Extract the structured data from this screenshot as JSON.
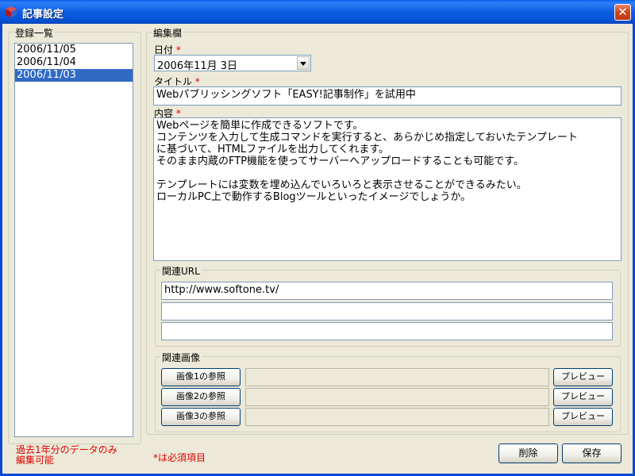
{
  "window": {
    "title": "記事設定",
    "close_label": "✕"
  },
  "list_panel": {
    "label": "登録一覧",
    "items": [
      "2006/11/05",
      "2006/11/04",
      "2006/11/03"
    ],
    "selected_index": 2,
    "note_line1": "過去1年分のデータのみ",
    "note_line2": "編集可能"
  },
  "edit_panel": {
    "label": "編集欄",
    "date_label": "日付",
    "date_value": "2006年11月  3日",
    "title_label": "タイトル",
    "title_value": "Webパブリッシングソフト「EASY!記事制作」を試用中",
    "content_label": "内容",
    "content_value": "Webページを簡単に作成できるソフトです。\nコンテンツを入力して生成コマンドを実行すると、あらかじめ指定しておいたテンプレート\nに基づいて、HTMLファイルを出力してくれます。\nそのまま内蔵のFTP機能を使ってサーバーへアップロードすることも可能です。\n\nテンプレートには変数を埋め込んでいろいろと表示させることができるみたい。\nローカルPC上で動作するBlogツールといったイメージでしょうか。",
    "required_mark": "*"
  },
  "related_url": {
    "label": "関連URL",
    "urls": [
      "http://www.softone.tv/",
      "",
      ""
    ]
  },
  "related_images": {
    "label": "関連画像",
    "rows": [
      {
        "browse_label": "画像1の参照",
        "path": "",
        "preview_label": "プレビュー"
      },
      {
        "browse_label": "画像2の参照",
        "path": "",
        "preview_label": "プレビュー"
      },
      {
        "browse_label": "画像3の参照",
        "path": "",
        "preview_label": "プレビュー"
      }
    ]
  },
  "footer": {
    "required_note": "*は必須項目",
    "delete_label": "削除",
    "save_label": "保存"
  },
  "colors": {
    "titlebar": "#0a5fe8",
    "selection": "#316ac5",
    "required": "#e00000"
  }
}
